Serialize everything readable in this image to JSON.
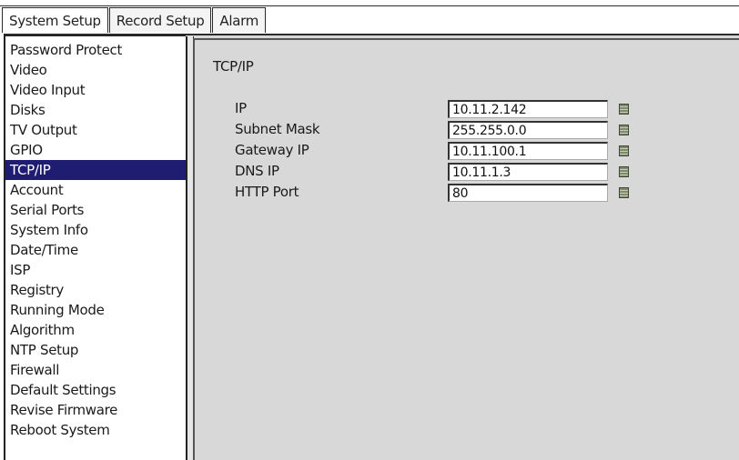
{
  "tabs": [
    {
      "label": "System Setup",
      "active": true
    },
    {
      "label": "Record Setup",
      "active": false
    },
    {
      "label": "Alarm",
      "active": false
    }
  ],
  "sidebar": {
    "items": [
      {
        "label": "Password Protect"
      },
      {
        "label": "Video"
      },
      {
        "label": "Video Input"
      },
      {
        "label": "Disks"
      },
      {
        "label": "TV Output"
      },
      {
        "label": "GPIO"
      },
      {
        "label": "TCP/IP",
        "selected": true
      },
      {
        "label": "Account"
      },
      {
        "label": "Serial Ports"
      },
      {
        "label": "System Info"
      },
      {
        "label": "Date/Time"
      },
      {
        "label": "ISP"
      },
      {
        "label": "Registry"
      },
      {
        "label": "Running Mode"
      },
      {
        "label": "Algorithm"
      },
      {
        "label": "NTP Setup"
      },
      {
        "label": "Firewall"
      },
      {
        "label": "Default Settings"
      },
      {
        "label": "Revise Firmware"
      },
      {
        "label": "Reboot System"
      }
    ]
  },
  "main": {
    "title": "TCP/IP",
    "fields": [
      {
        "label": "IP",
        "value": "10.11.2.142",
        "icon": "keyboard-icon"
      },
      {
        "label": "Subnet Mask",
        "value": "255.255.0.0",
        "icon": "keyboard-icon"
      },
      {
        "label": "Gateway IP",
        "value": "10.11.100.1",
        "icon": "keyboard-icon"
      },
      {
        "label": "DNS IP",
        "value": "10.11.1.3",
        "icon": "keyboard-icon"
      },
      {
        "label": "HTTP Port",
        "value": "80",
        "icon": "keyboard-icon"
      }
    ]
  },
  "colors": {
    "selection": "#1f1d72",
    "panel": "#d8d8d8"
  }
}
